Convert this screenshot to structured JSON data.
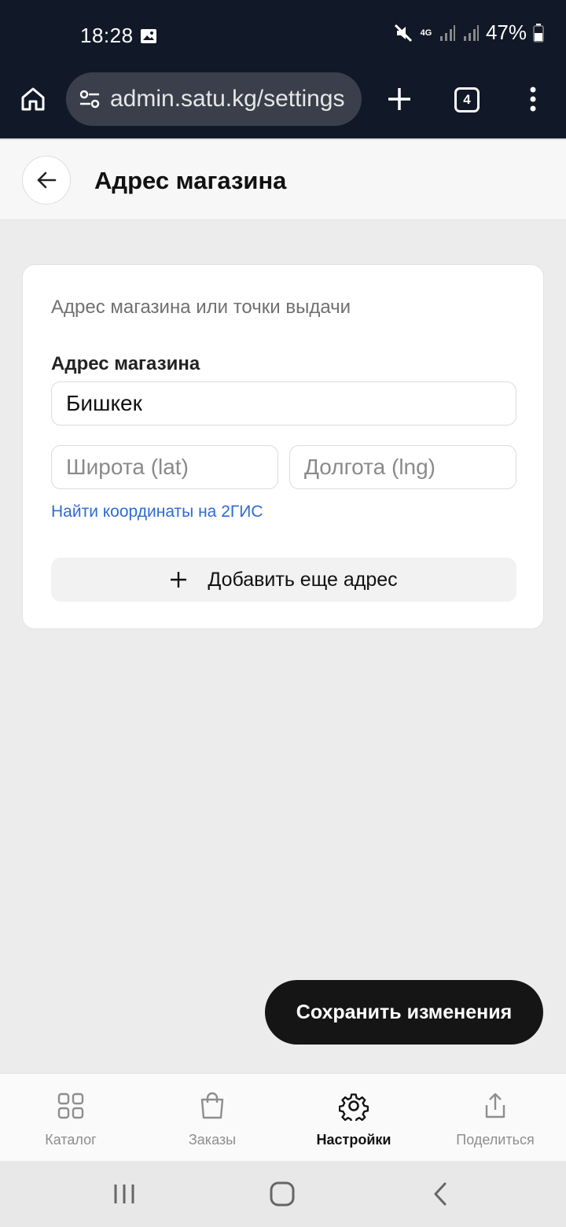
{
  "status_bar": {
    "time": "18:28",
    "network": "4G",
    "battery": "47%",
    "icons": [
      "image-icon",
      "mute-icon",
      "signal-icon",
      "battery-icon"
    ]
  },
  "browser": {
    "url": "admin.satu.kg/settings",
    "tab_count": "4"
  },
  "header": {
    "title": "Адрес магазина"
  },
  "card": {
    "subtitle": "Адрес магазина или точки выдачи",
    "address_label": "Адрес магазина",
    "address_value": "Бишкек",
    "lat_placeholder": "Широта (lat)",
    "lng_placeholder": "Долгота (lng)",
    "gis_link": "Найти координаты на 2ГИС",
    "add_address_label": "Добавить еще адрес"
  },
  "save_button": "Сохранить изменения",
  "bottom_nav": {
    "items": [
      {
        "label": "Каталог",
        "icon": "grid-icon",
        "active": false
      },
      {
        "label": "Заказы",
        "icon": "bag-icon",
        "active": false
      },
      {
        "label": "Настройки",
        "icon": "gear-icon",
        "active": true
      },
      {
        "label": "Поделиться",
        "icon": "share-icon",
        "active": false
      }
    ]
  },
  "colors": {
    "system_bar": "#111827",
    "link": "#2f6bd3",
    "primary_button": "#151515",
    "background": "#ececec"
  }
}
